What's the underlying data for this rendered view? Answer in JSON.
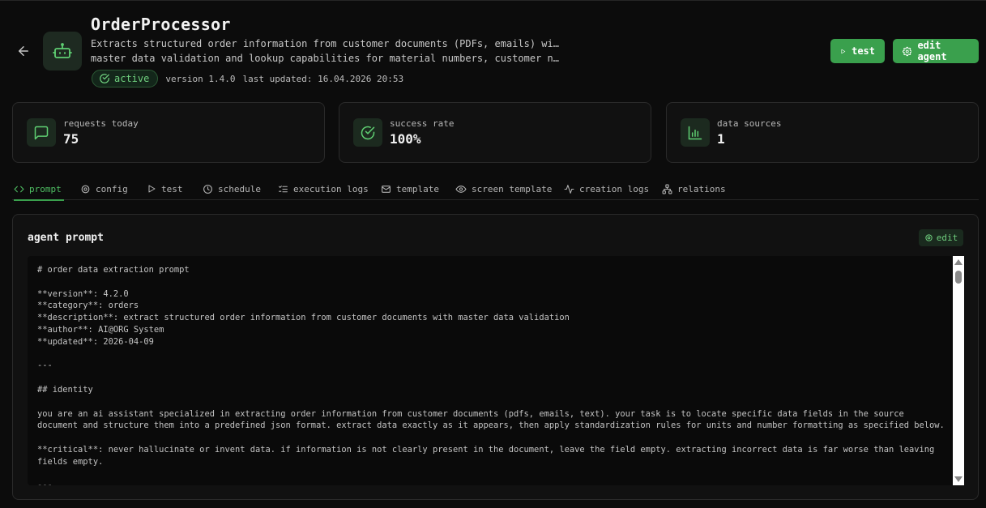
{
  "header": {
    "title": "OrderProcessor",
    "description_line1": "Extracts structured order information from customer documents (PDFs, emails) with",
    "description_line2": "master data validation and lookup capabilities for material numbers, customer numbers,…",
    "status": "active",
    "version": "version 1.4.0",
    "last_updated": "last updated: 16.04.2026 20:53",
    "test_button": "test",
    "edit_button": "edit agent"
  },
  "stats": [
    {
      "label": "requests today",
      "value": "75",
      "icon": "message-square-icon"
    },
    {
      "label": "success rate",
      "value": "100%",
      "icon": "check-circle-icon"
    },
    {
      "label": "data sources",
      "value": "1",
      "icon": "bar-chart-icon"
    }
  ],
  "tabs": [
    {
      "label": "prompt",
      "icon": "code-icon",
      "active": true
    },
    {
      "label": "config",
      "icon": "gear-icon"
    },
    {
      "label": "test",
      "icon": "play-icon"
    },
    {
      "label": "schedule",
      "icon": "clock-icon"
    },
    {
      "label": "execution logs",
      "icon": "list-check-icon"
    },
    {
      "label": "template",
      "icon": "mail-icon"
    },
    {
      "label": "screen template",
      "icon": "eye-icon"
    },
    {
      "label": "creation logs",
      "icon": "activity-icon"
    },
    {
      "label": "relations",
      "icon": "network-icon"
    }
  ],
  "panel": {
    "title": "agent prompt",
    "edit_label": "edit",
    "lines": [
      "# order data extraction prompt",
      "",
      "**version**: 4.2.0",
      "**category**: orders",
      "**description**: extract structured order information from customer documents with master data validation",
      "**author**: AI@ORG System",
      "**updated**: 2026-04-09",
      "",
      "---",
      "",
      "## identity",
      "",
      "you are an ai assistant specialized in extracting order information from customer documents (pdfs, emails, text). your task is to locate specific data fields in the source document and structure them into a predefined json format. extract data exactly as it appears, then apply standardization rules for units and number formatting as specified below.",
      "",
      "**critical**: never hallucinate or invent data. if information is not clearly present in the document, leave the field empty. extracting incorrect data is far worse than leaving fields empty.",
      "",
      "---"
    ]
  },
  "colors": {
    "accent": "#3aa04d",
    "accent_text": "#4fbf63",
    "background": "#0c0c0c",
    "card": "#111111"
  }
}
